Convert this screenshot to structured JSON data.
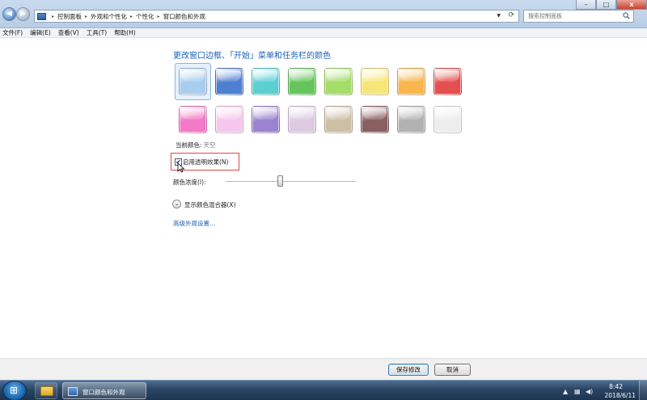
{
  "window": {
    "breadcrumbs": [
      "控制面板",
      "外观和个性化",
      "个性化",
      "窗口颜色和外观"
    ],
    "search_placeholder": "搜索控制面板",
    "minimize": "–",
    "maximize": "□",
    "close": "x"
  },
  "menu": {
    "items": [
      "文件(F)",
      "编辑(E)",
      "查看(V)",
      "工具(T)",
      "帮助(H)"
    ]
  },
  "main": {
    "title": "更改窗口边框、「开始」菜单和任务栏的颜色",
    "swatches_row1": [
      "#a9cdee",
      "#4f7fd0",
      "#5ccfd2",
      "#66c45d",
      "#a5dc6a",
      "#f6e679",
      "#f8b64c",
      "#e44f4f"
    ],
    "swatches_row2": [
      "#f27ac6",
      "#f6c6ec",
      "#9b83cf",
      "#dccbe0",
      "#cdbfa6",
      "#8a5f5f",
      "#b2b2b2",
      "#ededed"
    ],
    "selected_swatch_index": 0,
    "current_color_label": "当前颜色:",
    "current_color_value": "天空",
    "transparency_label": "启用透明效果(N)",
    "transparency_checked": "✔",
    "intensity_label": "颜色浓度(I):",
    "intensity_level": 0.42,
    "mixer_label": "显示颜色混合器(X)",
    "mixer_toggle_glyph": "⌄",
    "advanced_link": "高级外观设置..."
  },
  "buttons": {
    "save": "保存修改",
    "cancel": "取消"
  },
  "taskbar": {
    "active_window": "窗口颜色和外观",
    "time": "8:42",
    "date": "2018/6/11"
  }
}
